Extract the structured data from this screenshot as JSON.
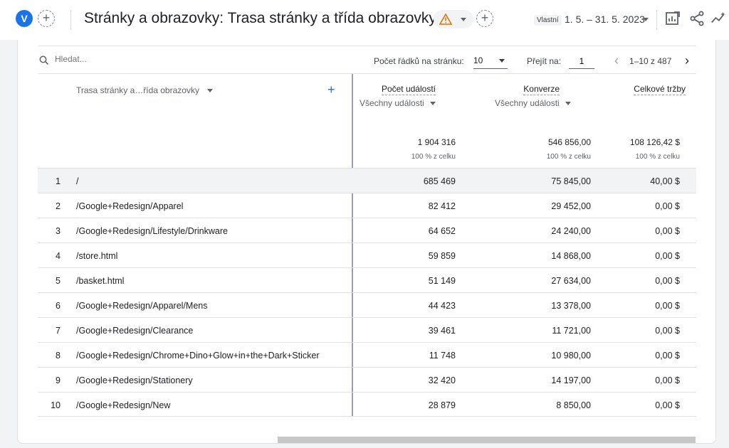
{
  "header": {
    "avatar_letter": "V",
    "title": "Stránky a obrazovky: Trasa stránky a třída obrazovky",
    "date_chip": "Vlastní",
    "date_range": "1. 5. – 31. 5. 2023"
  },
  "toolbar": {
    "search_placeholder": "Hledat...",
    "rows_label": "Počet řádků na stránku:",
    "rows_value": "10",
    "goto_label": "Přejít na:",
    "goto_value": "1",
    "pager_text": "1–10 z 487"
  },
  "table": {
    "dimension_header": "Trasa stránky a…řída obrazovky",
    "metrics": [
      {
        "label": "Počet událostí",
        "sub": "Všechny události",
        "total": "1 904 316",
        "total_pct": "100 % z celku"
      },
      {
        "label": "Konverze",
        "sub": "Všechny události",
        "total": "546 856,00",
        "total_pct": "100 % z celku"
      },
      {
        "label": "Celkové tržby",
        "sub": "",
        "total": "108 126,42 $",
        "total_pct": "100 % z celku"
      }
    ],
    "rows": [
      {
        "idx": "1",
        "path": "/",
        "events": "685 469",
        "conversions": "75 845,00",
        "revenue": "40,00 $"
      },
      {
        "idx": "2",
        "path": "/Google+Redesign/Apparel",
        "events": "82 412",
        "conversions": "29 452,00",
        "revenue": "0,00 $"
      },
      {
        "idx": "3",
        "path": "/Google+Redesign/Lifestyle/Drinkware",
        "events": "64 652",
        "conversions": "24 240,00",
        "revenue": "0,00 $"
      },
      {
        "idx": "4",
        "path": "/store.html",
        "events": "59 859",
        "conversions": "14 868,00",
        "revenue": "0,00 $"
      },
      {
        "idx": "5",
        "path": "/basket.html",
        "events": "51 149",
        "conversions": "27 634,00",
        "revenue": "0,00 $"
      },
      {
        "idx": "6",
        "path": "/Google+Redesign/Apparel/Mens",
        "events": "44 423",
        "conversions": "13 378,00",
        "revenue": "0,00 $"
      },
      {
        "idx": "7",
        "path": "/Google+Redesign/Clearance",
        "events": "39 461",
        "conversions": "11 721,00",
        "revenue": "0,00 $"
      },
      {
        "idx": "8",
        "path": "/Google+Redesign/Chrome+Dino+Glow+in+the+Dark+Sticker",
        "events": "11 748",
        "conversions": "10 980,00",
        "revenue": "0,00 $"
      },
      {
        "idx": "9",
        "path": "/Google+Redesign/Stationery",
        "events": "32 420",
        "conversions": "14 197,00",
        "revenue": "0,00 $"
      },
      {
        "idx": "10",
        "path": "/Google+Redesign/New",
        "events": "28 879",
        "conversions": "8 850,00",
        "revenue": "0,00 $"
      }
    ]
  },
  "colors": {
    "accent": "#1a73e8",
    "warning": "#e37400"
  },
  "icons": [
    "add-comparison-icon",
    "warning-icon",
    "customize-report-icon",
    "share-icon",
    "insights-icon",
    "search-icon",
    "chevron-left-icon",
    "chevron-right-icon",
    "add-dimension-icon"
  ]
}
